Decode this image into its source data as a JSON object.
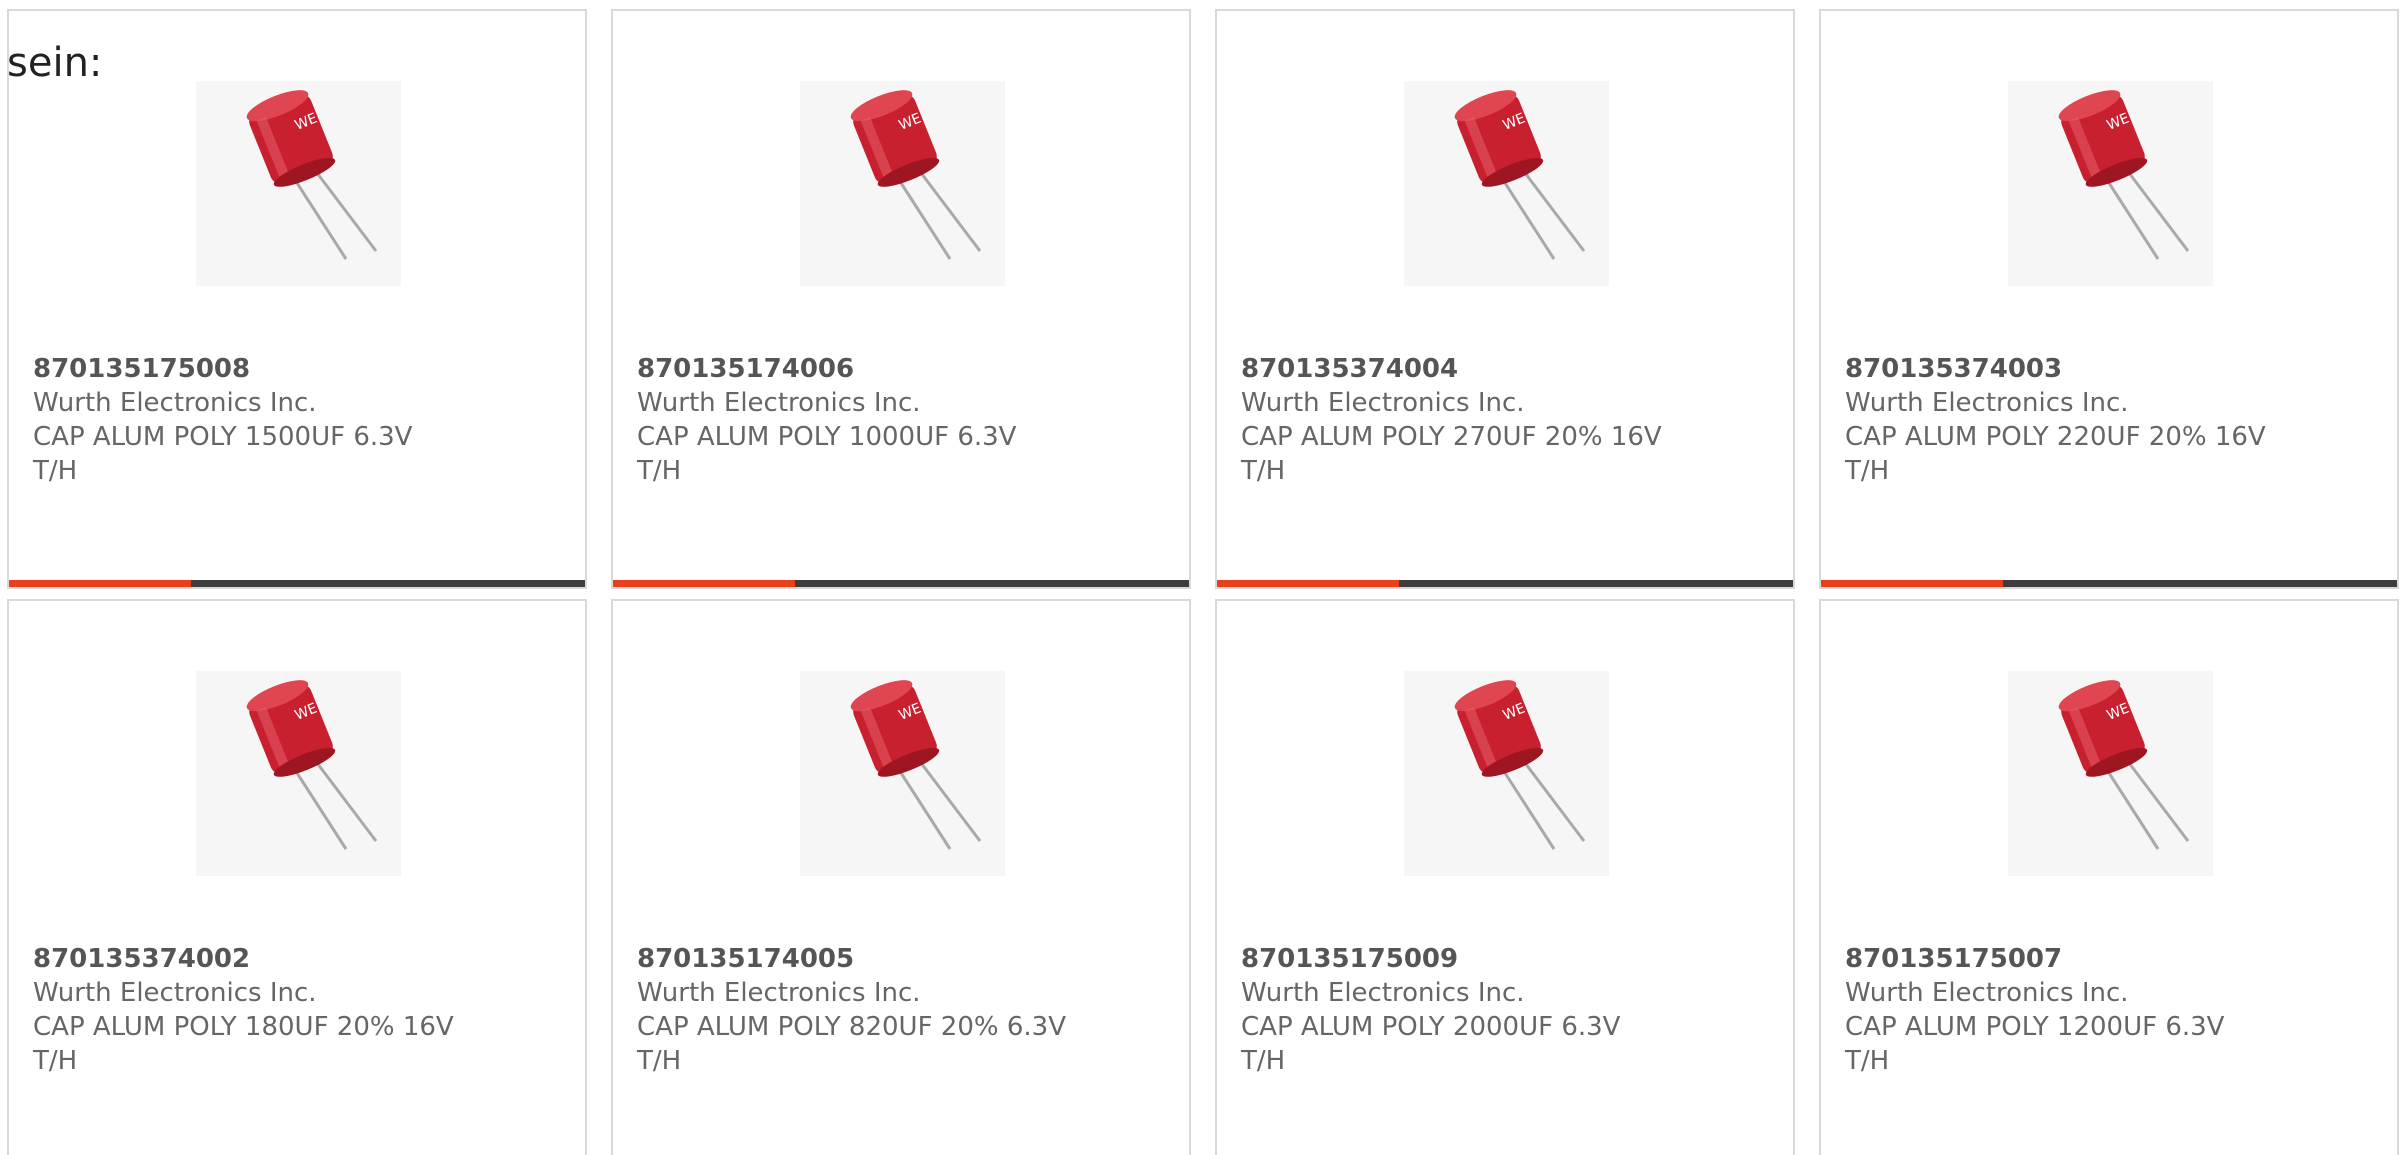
{
  "intro_text": "sein:",
  "colors": {
    "progress_fill": "#e8401c",
    "progress_track": "#3d3d3d",
    "card_border": "#d9d9d9",
    "capacitor_body": "#c8202f"
  },
  "products": [
    {
      "part_number": "870135175008",
      "manufacturer": "Wurth Electronics Inc.",
      "description_line1": "CAP ALUM POLY 1500UF 6.3V",
      "description_line2": "T/H",
      "image_icon": "capacitor-image",
      "carousel_progress": 0.316
    },
    {
      "part_number": "870135174006",
      "manufacturer": "Wurth Electronics Inc.",
      "description_line1": "CAP ALUM POLY 1000UF 6.3V",
      "description_line2": "T/H",
      "image_icon": "capacitor-image",
      "carousel_progress": 0.316
    },
    {
      "part_number": "870135374004",
      "manufacturer": "Wurth Electronics Inc.",
      "description_line1": "CAP ALUM POLY 270UF 20% 16V",
      "description_line2": "T/H",
      "image_icon": "capacitor-image",
      "carousel_progress": 0.316
    },
    {
      "part_number": "870135374003",
      "manufacturer": "Wurth Electronics Inc.",
      "description_line1": "CAP ALUM POLY 220UF 20% 16V",
      "description_line2": "T/H",
      "image_icon": "capacitor-image",
      "carousel_progress": 0.316
    },
    {
      "part_number": "870135374002",
      "manufacturer": "Wurth Electronics Inc.",
      "description_line1": "CAP ALUM POLY 180UF 20% 16V",
      "description_line2": "T/H",
      "image_icon": "capacitor-image"
    },
    {
      "part_number": "870135174005",
      "manufacturer": "Wurth Electronics Inc.",
      "description_line1": "CAP ALUM POLY 820UF 20% 6.3V",
      "description_line2": "T/H",
      "image_icon": "capacitor-image"
    },
    {
      "part_number": "870135175009",
      "manufacturer": "Wurth Electronics Inc.",
      "description_line1": "CAP ALUM POLY 2000UF 6.3V",
      "description_line2": "T/H",
      "image_icon": "capacitor-image"
    },
    {
      "part_number": "870135175007",
      "manufacturer": "Wurth Electronics Inc.",
      "description_line1": "CAP ALUM POLY 1200UF 6.3V",
      "description_line2": "T/H",
      "image_icon": "capacitor-image"
    }
  ]
}
